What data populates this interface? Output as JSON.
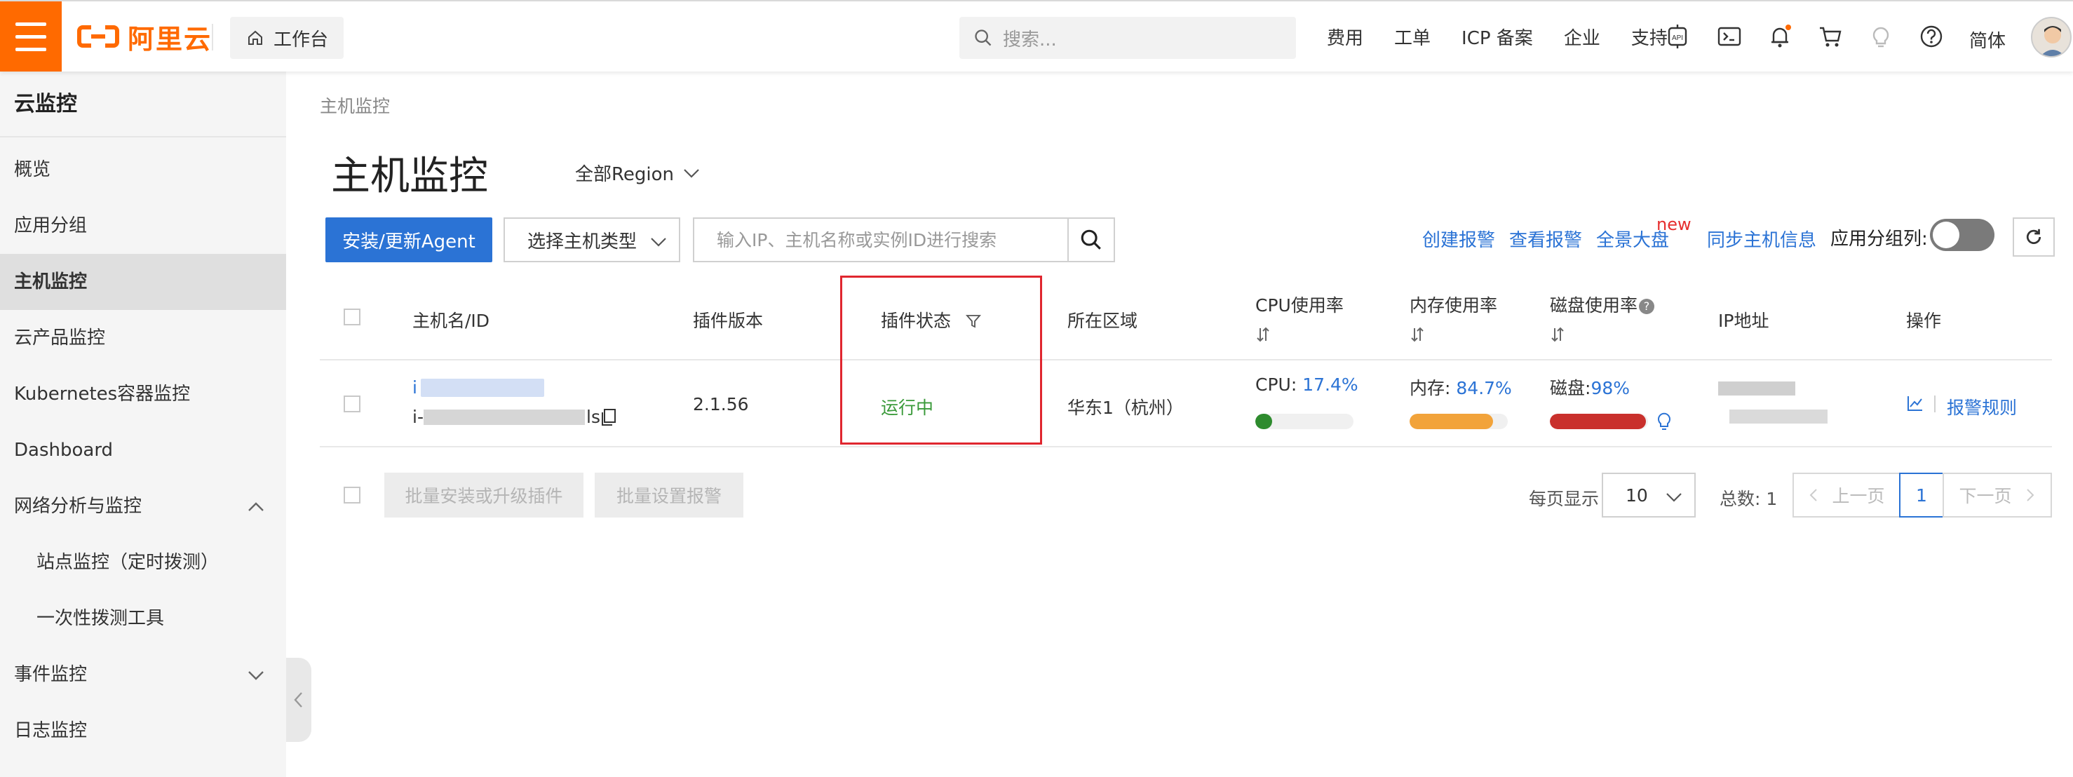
{
  "topbar": {
    "logo_text": "阿里云",
    "workbench_label": "工作台",
    "search_placeholder": "搜索...",
    "nav_links": [
      "费用",
      "工单",
      "ICP 备案",
      "企业",
      "支持"
    ],
    "language": "简体",
    "icons": [
      "api-icon",
      "terminal-icon",
      "bell-icon",
      "cart-icon",
      "lightbulb-icon",
      "help-icon"
    ],
    "brand_color": "#ff6a00"
  },
  "sidebar": {
    "title": "云监控",
    "items": [
      {
        "label": "概览"
      },
      {
        "label": "应用分组"
      },
      {
        "label": "主机监控",
        "active": true
      },
      {
        "label": "云产品监控"
      },
      {
        "label": "Kubernetes容器监控"
      },
      {
        "label": "Dashboard"
      },
      {
        "label": "网络分析与监控",
        "expanded": true
      },
      {
        "label": "站点监控（定时拨测）",
        "sub": true
      },
      {
        "label": "一次性拨测工具",
        "sub": true
      },
      {
        "label": "事件监控",
        "collapsed": true
      },
      {
        "label": "日志监控"
      }
    ]
  },
  "main": {
    "breadcrumb": "主机监控",
    "title": "主机监控",
    "region": "全部Region",
    "toolbar": {
      "install_button": "安装/更新Agent",
      "host_type_select": "选择主机类型",
      "search_placeholder": "输入IP、主机名称或实例ID进行搜索",
      "links": [
        "创建报警",
        "查看报警",
        "全景大盘",
        "同步主机信息"
      ],
      "new_badge": "new",
      "group_toggle_label": "应用分组列:"
    },
    "table": {
      "headers": {
        "host": "主机名/ID",
        "plugin_version": "插件版本",
        "plugin_status": "插件状态",
        "region": "所在区域",
        "cpu": "CPU使用率",
        "memory": "内存使用率",
        "disk": "磁盘使用率",
        "ip": "IP地址",
        "actions": "操作"
      },
      "rows": [
        {
          "host_name_prefix": "i",
          "host_id_prefix": "i-",
          "host_id_suffix": "ls",
          "plugin_version": "2.1.56",
          "plugin_status": "运行中",
          "region": "华东1（杭州）",
          "cpu_label": "CPU:",
          "cpu_value": "17.4%",
          "cpu_fraction": 0.174,
          "cpu_color": "#2e8b2e",
          "memory_label": "内存:",
          "memory_value": "84.7%",
          "memory_fraction": 0.847,
          "memory_color": "#f2a33a",
          "disk_label": "磁盘:",
          "disk_value": "98%",
          "disk_fraction": 0.98,
          "disk_color": "#c9302c",
          "action_rules": "报警规则"
        }
      ]
    },
    "footer": {
      "batch_install": "批量安装或升级插件",
      "batch_alarm": "批量设置报警",
      "per_page_label": "每页显示",
      "page_size": "10",
      "total": "总数: 1",
      "prev": "上一页",
      "current_page": "1",
      "next": "下一页"
    },
    "status_color": "#3a9a3a",
    "link_color": "#2b73d5"
  }
}
